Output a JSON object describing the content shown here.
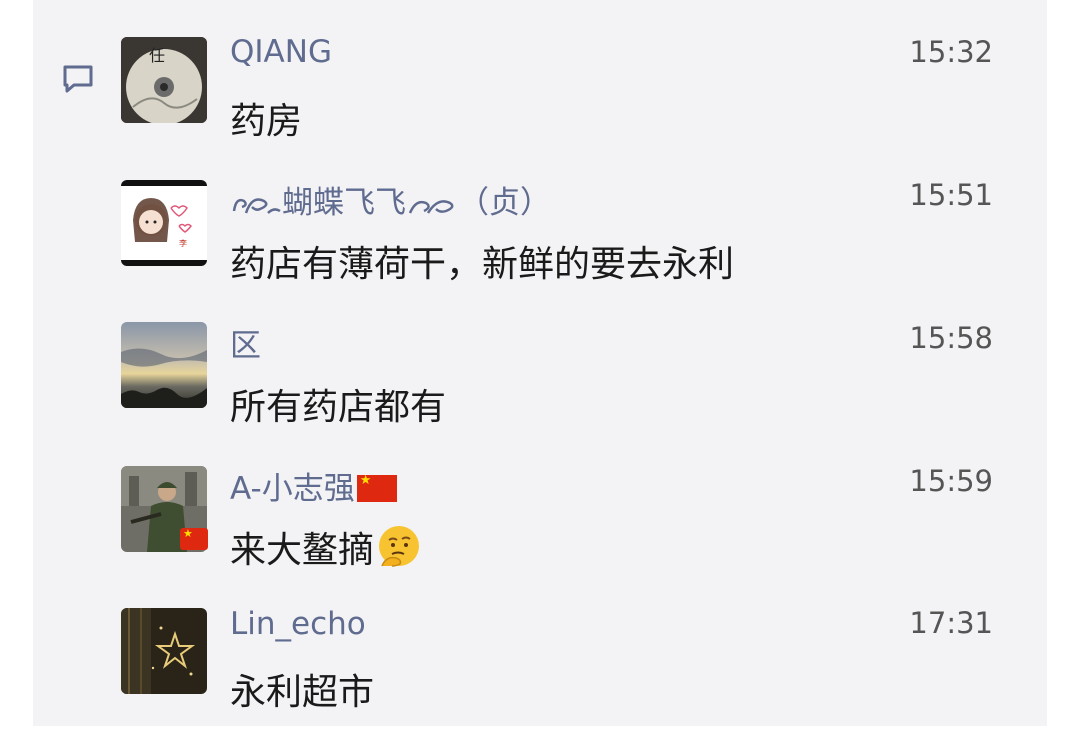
{
  "messages": [
    {
      "name": "QIANG",
      "time": "15:32",
      "text": "药房",
      "avatar_icon": "cd-disc-icon"
    },
    {
      "name_prefix": "",
      "name": "蝴蝶飞飞",
      "name_suffix": "（贞）",
      "time": "15:51",
      "text": "药店有薄荷干，新鲜的要去永利",
      "avatar_icon": "cartoon-girl-icon"
    },
    {
      "name": "区",
      "time": "15:58",
      "text": "所有药店都有",
      "avatar_icon": "sunset-sky-icon"
    },
    {
      "name": "A-小志强",
      "time": "15:59",
      "text": "来大鳌摘",
      "avatar_icon": "soldier-icon",
      "flag_icon": "china-flag-icon",
      "emoji_icon": "thinking-face-emoji"
    },
    {
      "name": "Lin_echo",
      "time": "17:31",
      "text": "永利超市",
      "avatar_icon": "star-light-icon"
    }
  ],
  "colors": {
    "name": "#5f6b8f",
    "background": "#f3f3f5",
    "text": "#1a1a1a",
    "time": "#555555"
  }
}
